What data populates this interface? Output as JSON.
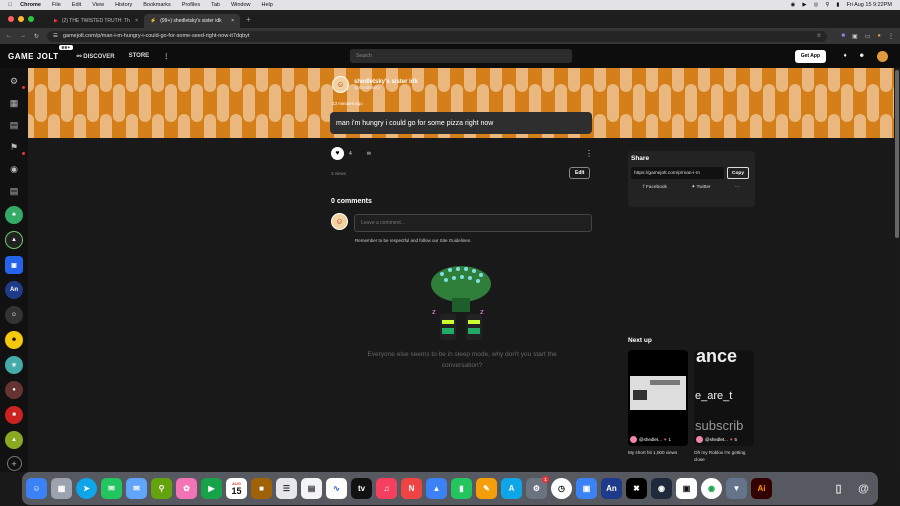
{
  "macmenu": {
    "app": "Chrome",
    "items": [
      "File",
      "Edit",
      "View",
      "History",
      "Bookmarks",
      "Profiles",
      "Tab",
      "Window",
      "Help"
    ],
    "datetime": "Fri Aug 15  9:22PM"
  },
  "tabs": [
    {
      "label": "(2) THE TWISTED TRUTH: Th"
    },
    {
      "label": "(99+) shedletsky's sister idk"
    }
  ],
  "address": {
    "url": "gamejolt.com/p/man-i-m-hungry-i-could-go-for-some-seed-right-now-it7dqbyt"
  },
  "gjnav": {
    "logo": "GAME JOLT",
    "badge": "99+",
    "discover": "DISCOVER",
    "store": "STORE",
    "search_placeholder": "Search",
    "get_app": "Get App"
  },
  "sidebar_games": [
    "An"
  ],
  "post": {
    "author_name": "shedletsky's sister idk",
    "author_handle": "@shedletsky",
    "time": "13 minutes ago",
    "body": "man i'm hungry i could go for some pizza right now",
    "likes": "4",
    "views": "3 views",
    "edit_label": "Edit"
  },
  "comments": {
    "title": "0 comments",
    "placeholder": "Leave a comment...",
    "note": "Remember to be respectful and follow our Site Guidelines.",
    "empty_text": "Everyone else seems to be in sleep mode, why don't you start the conversation?"
  },
  "share": {
    "title": "Share",
    "url": "https://gamejolt.com/p/man-i-m",
    "copy": "Copy",
    "facebook": "Facebook",
    "twitter": "Twitter"
  },
  "nextup": {
    "title": "Next up",
    "videos": [
      {
        "title": "My short hit 1,000 views",
        "author": "@shedlet...",
        "likes": "1"
      },
      {
        "title": "Oh my Roblox I'm getting close",
        "author": "@shedlet...",
        "likes": "5"
      }
    ],
    "overlay_texts": [
      "ance",
      "e_are_t",
      "subscrib"
    ]
  },
  "dock": {
    "calendar_month": "AUG",
    "calendar_day": "15",
    "badge": "1"
  },
  "colors": {
    "banner": "#d47f1a",
    "accent_green": "#2f7f3a"
  }
}
